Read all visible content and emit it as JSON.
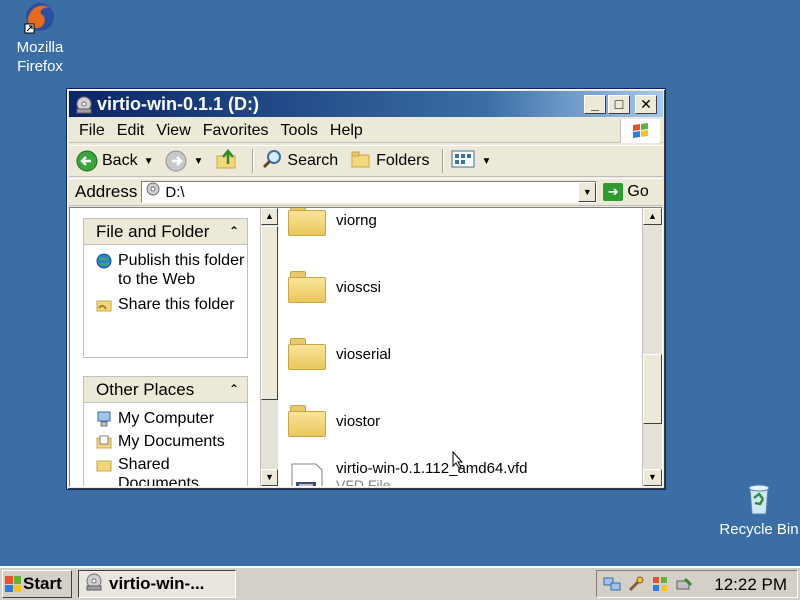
{
  "desktop": {
    "icons": [
      {
        "label": "Mozilla Firefox"
      },
      {
        "label": "Recycle Bin"
      }
    ]
  },
  "window": {
    "title": "virtio-win-0.1.1 (D:)",
    "controls": {
      "minimize": "_",
      "maximize": "□",
      "close": "✕"
    }
  },
  "menubar": {
    "items": [
      "File",
      "Edit",
      "View",
      "Favorites",
      "Tools",
      "Help"
    ]
  },
  "toolbar": {
    "back_label": "Back",
    "search_label": "Search",
    "folders_label": "Folders"
  },
  "address": {
    "label": "Address",
    "value": "D:\\",
    "go_label": "Go"
  },
  "tasks": {
    "file_folder": {
      "title": "File and Folder",
      "items": [
        "Publish this folder to the Web",
        "Share this folder"
      ]
    },
    "other_places": {
      "title": "Other Places",
      "items": [
        "My Computer",
        "My Documents",
        "Shared Documents"
      ]
    }
  },
  "files": [
    {
      "name": "viorng",
      "type": "folder"
    },
    {
      "name": "vioscsi",
      "type": "folder"
    },
    {
      "name": "vioserial",
      "type": "folder"
    },
    {
      "name": "viostor",
      "type": "folder"
    },
    {
      "name": "virtio-win-0.1.112_amd64.vfd",
      "subtitle": "VFD File",
      "type": "file"
    }
  ],
  "taskbar": {
    "start_label": "Start",
    "task_label": "virtio-win-...",
    "clock": "12:22 PM"
  },
  "colors": {
    "desktop": "#3a6ea5",
    "titlebar_start": "#0a246a",
    "titlebar_end": "#a6caf0",
    "folder": "#f2d77b"
  }
}
